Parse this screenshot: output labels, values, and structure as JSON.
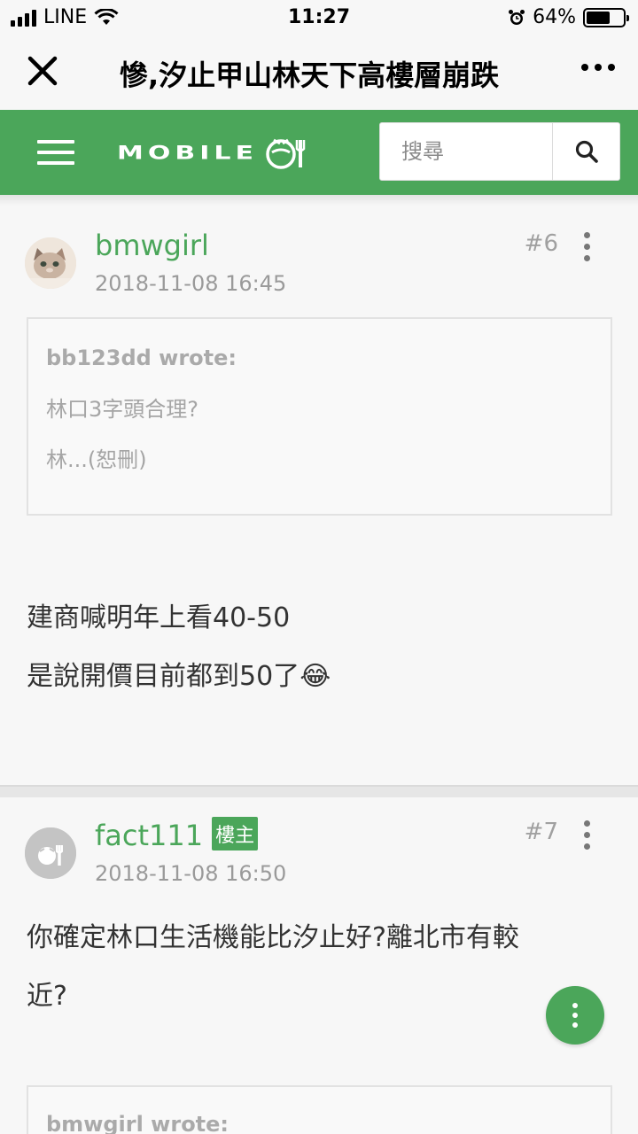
{
  "status_bar": {
    "carrier": "LINE",
    "time": "11:27",
    "battery_percent": "64%",
    "battery_level": 0.64
  },
  "nav": {
    "title": "慘,汐止甲山林天下高樓層崩跌"
  },
  "header": {
    "logo_text": "MOBILE",
    "search_placeholder": "搜尋",
    "accent_color": "#4ba65a"
  },
  "posts": [
    {
      "username": "bmwgirl",
      "timestamp": "2018-11-08 16:45",
      "floor": "#6",
      "quote": {
        "author": "bb123dd wrote:",
        "lines": [
          "林口3字頭合理?",
          "林...(恕刪)"
        ]
      },
      "body": [
        "建商喊明年上看40-50",
        "是說開價目前都到50了"
      ],
      "emoji": "😂"
    },
    {
      "username": "fact111",
      "badge": "樓主",
      "timestamp": "2018-11-08 16:50",
      "floor": "#7",
      "body": [
        "你確定林口生活機能比汐止好?離北市有較",
        "近?"
      ],
      "quote": {
        "author": "bmwgirl wrote:"
      }
    }
  ]
}
